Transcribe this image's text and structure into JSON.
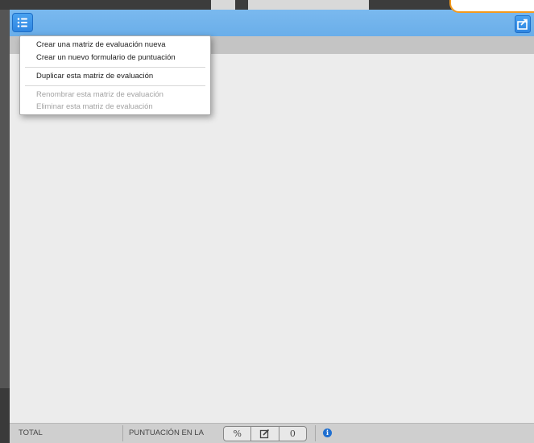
{
  "menu": {
    "items": [
      {
        "label": "Crear una matriz de evaluación nueva",
        "enabled": true
      },
      {
        "label": "Crear un nuevo formulario de puntuación",
        "enabled": true
      },
      {
        "label": "Duplicar esta matriz de evaluación",
        "enabled": true
      },
      {
        "label": "Renombrar esta matriz de evaluación",
        "enabled": false
      },
      {
        "label": "Eliminar esta matriz de evaluación",
        "enabled": false
      }
    ]
  },
  "footer": {
    "total_label": "TOTAL",
    "score_label": "PUNTUACIÓN EN LA",
    "percent_symbol": "%",
    "score_value": "0"
  },
  "icons": {
    "menu": "list-icon",
    "share": "share-icon",
    "edit": "edit-icon",
    "info": "info-icon"
  },
  "colors": {
    "toolbar": "#6aaee9",
    "button": "#2e86e2",
    "callout_border": "#f39a1e",
    "info": "#1f6fd0"
  }
}
